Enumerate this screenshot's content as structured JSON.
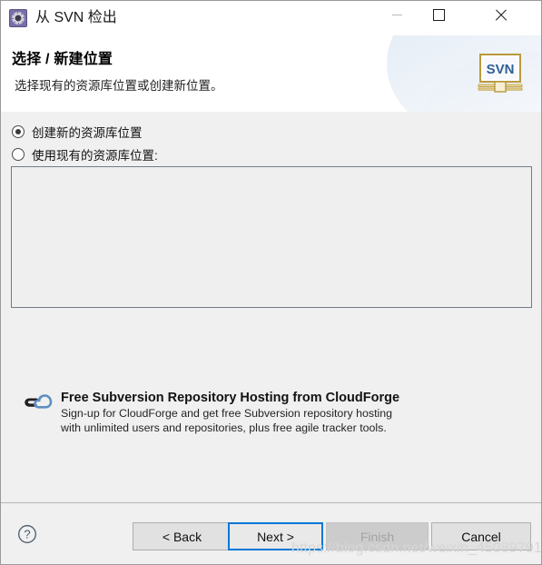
{
  "window": {
    "title": "从 SVN 检出",
    "app_icon": "svn-gear-icon",
    "controls": {
      "minimize": "minimize-icon",
      "maximize": "maximize-icon",
      "close": "close-icon"
    }
  },
  "header": {
    "title": "选择 / 新建位置",
    "subtitle": "选择现有的资源库位置或创建新位置。",
    "banner_icon_text": "SVN"
  },
  "body": {
    "radios": [
      {
        "label": "创建新的资源库位置",
        "checked": true
      },
      {
        "label": "使用现有的资源库位置:",
        "checked": false
      }
    ],
    "list": {
      "items": [],
      "empty": ""
    },
    "promo": {
      "title": "Free Subversion Repository Hosting from CloudForge",
      "line1": "Sign-up for CloudForge and get free Subversion repository hosting",
      "line2": "with unlimited users and repositories, plus free agile tracker tools.",
      "icon": "cloud-link-icon"
    }
  },
  "footer": {
    "help_icon": "help-icon",
    "buttons": {
      "back": "< Back",
      "next": "Next >",
      "finish": "Finish",
      "cancel": "Cancel"
    }
  },
  "watermark": "https://blog.csdn.net/weixin_45089791",
  "colors": {
    "focus_blue": "#0078d7",
    "dialog_bg": "#f0f0f0",
    "header_bg": "#ffffff",
    "list_border": "#737b86",
    "disabled_text": "#a3a3a3"
  }
}
